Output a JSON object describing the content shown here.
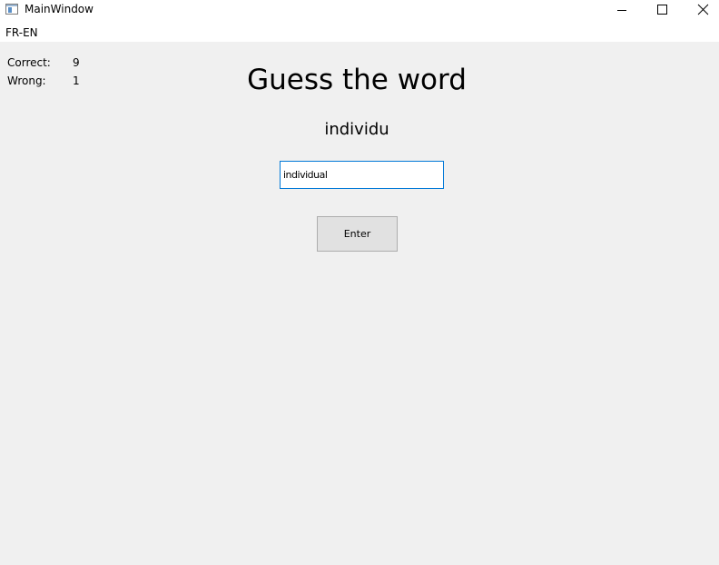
{
  "window": {
    "title": "MainWindow",
    "icon": "app-window-icon",
    "controls": [
      "minimize-icon",
      "maximize-icon",
      "close-icon"
    ]
  },
  "menu": {
    "items": [
      {
        "label": "FR-EN"
      }
    ]
  },
  "stats": {
    "correct_label": "Correct:",
    "correct_value": "9",
    "wrong_label": "Wrong:",
    "wrong_value": "1"
  },
  "game": {
    "heading": "Guess the word",
    "word": "individu",
    "answer_value": "individual",
    "enter_label": "Enter"
  },
  "colors": {
    "background": "#f0f0f0",
    "input_focus_border": "#0078d7",
    "button_face": "#e1e1e1"
  }
}
